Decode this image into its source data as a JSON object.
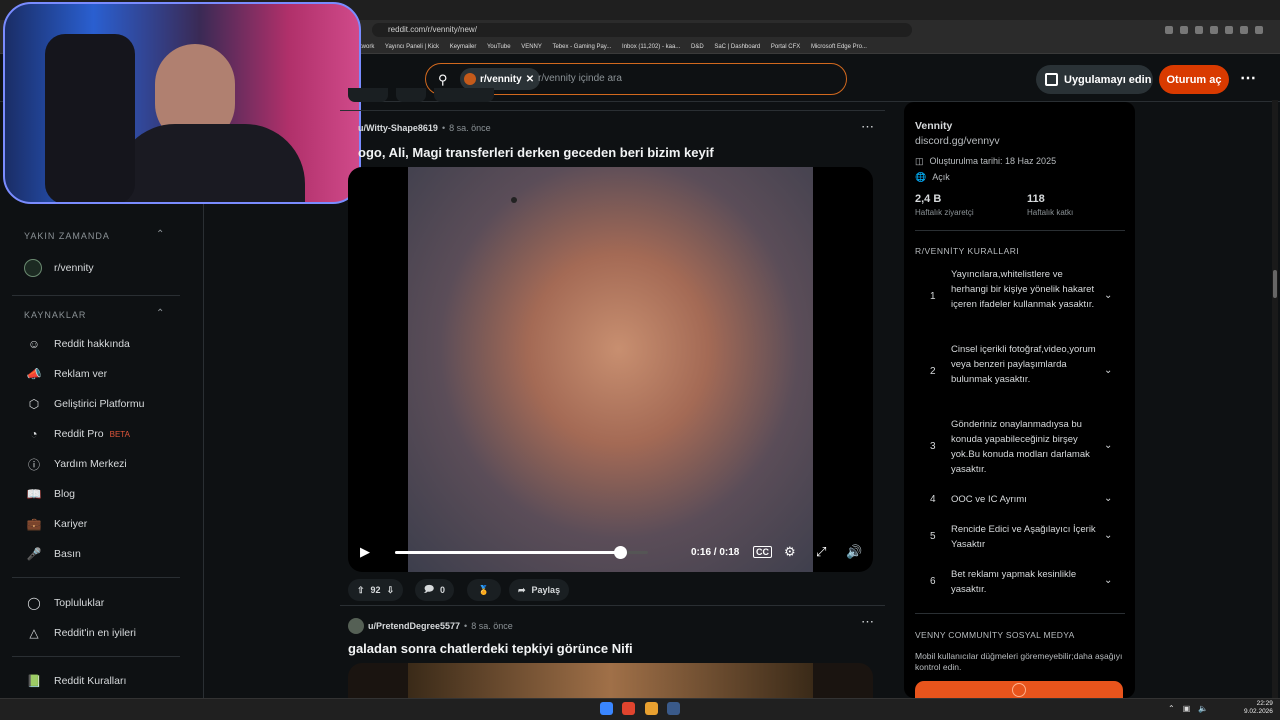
{
  "browser": {
    "url": "reddit.com/r/vennity/new/",
    "bookmarks": [
      "twork",
      "Yayıncı Paneli | Kick",
      "Keymailer",
      "YouTube",
      "VENNY",
      "Tebex - Gaming Pay...",
      "Inbox (11,202) - kaa...",
      "D&D",
      "SaC | Dashboard",
      "Portal CFX",
      "Microsoft Edge Pro..."
    ]
  },
  "header": {
    "search_chip": "r/vennity",
    "search_placeholder": "r/vennity içinde ara",
    "get_app": "Uygulamayı edin",
    "login": "Oturum aç"
  },
  "sidebar": {
    "recent_heading": "YAKIN ZAMANDA",
    "recent_item": "r/vennity",
    "resources_heading": "KAYNAKLAR",
    "resources": [
      {
        "label": "Reddit hakkında",
        "icon": "reddit-alien-icon"
      },
      {
        "label": "Reklam ver",
        "icon": "megaphone-icon"
      },
      {
        "label": "Geliştirici Platformu",
        "icon": "developer-platform-icon"
      },
      {
        "label": "Reddit Pro",
        "icon": "reddit-pro-icon",
        "badge": "BETA"
      },
      {
        "label": "Yardım Merkezi",
        "icon": "help-icon"
      },
      {
        "label": "Blog",
        "icon": "book-icon"
      },
      {
        "label": "Kariyer",
        "icon": "briefcase-icon"
      },
      {
        "label": "Basın",
        "icon": "microphone-icon"
      }
    ],
    "extra": [
      {
        "label": "Topluluklar",
        "icon": "communities-icon"
      },
      {
        "label": "Reddit'in en iyileri",
        "icon": "best-of-icon"
      }
    ],
    "rules_link": "Reddit Kuralları"
  },
  "posts": [
    {
      "author": "u/Witty-Shape8619",
      "time": "8 sa. önce",
      "title": "ogo, Ali, Magi transferleri derken geceden beri bizim keyif",
      "video_time": "0:16 / 0:18",
      "video_progress": 0.89,
      "votes": "92",
      "comments": "0",
      "share": "Paylaş"
    },
    {
      "author": "u/PretendDegree5577",
      "time": "8 sa. önce",
      "title": "galadan sonra chatlerdeki tepkiyi görünce Nifi"
    }
  ],
  "community": {
    "name": "Vennity",
    "link": "discord.gg/vennyv",
    "created": "Oluşturulma tarihi: 18 Haz 2025",
    "visibility": "Açık",
    "weekly_visitors": "2,4 B",
    "weekly_visitors_label": "Haftalık ziyaretçi",
    "weekly_contrib": "118",
    "weekly_contrib_label": "Haftalık katkı",
    "rules_heading": "R/VENNİTY KURALLARI",
    "rules": [
      {
        "num": "1",
        "text": "Yayıncılara,whitelistlere ve herhangi bir kişiye yönelik hakaret içeren ifadeler kullanmak yasaktır."
      },
      {
        "num": "2",
        "text": "Cinsel içerikli fotoğraf,video,yorum veya benzeri paylaşımlarda bulunmak yasaktır."
      },
      {
        "num": "3",
        "text": "Gönderiniz onaylanmadıysa bu konuda yapabileceğiniz birşey yok.Bu konuda modları darlamak yasaktır."
      },
      {
        "num": "4",
        "text": "OOC ve IC Ayrımı"
      },
      {
        "num": "5",
        "text": "Rencide Edici ve Aşağılayıcı İçerik Yasaktır"
      },
      {
        "num": "6",
        "text": "Bet reklamı yapmak kesinlikle yasaktır."
      }
    ],
    "social_heading": "VENNY COMMUNİTY SOSYAL MEDYA",
    "social_text": "Mobil kullanıcılar düğmeleri göremeyebilir;daha aşağıyı kontrol edin."
  },
  "taskbar": {
    "time": "22:29",
    "date": "9.02.2026"
  }
}
